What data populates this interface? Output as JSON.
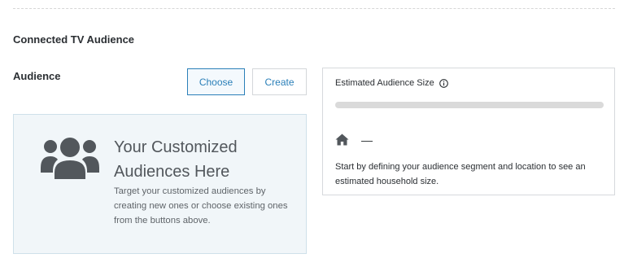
{
  "section": {
    "title": "Connected TV Audience"
  },
  "audience": {
    "label": "Audience",
    "choose_label": "Choose",
    "create_label": "Create"
  },
  "placeholder": {
    "icon": "people-group-icon",
    "title": "Your Customized Audiences Here",
    "text": "Target your customized audiences by creating new ones or choose existing ones from the buttons above."
  },
  "estimate": {
    "title": "Estimated Audience Size",
    "info_icon": "info-icon",
    "progress_fraction": 0,
    "household_icon": "home-icon",
    "household_value": "—",
    "help_text": "Start by defining your audience segment and location to see an estimated household size."
  },
  "colors": {
    "accent": "#2a7fb8",
    "card_background": "#f1f6f9",
    "progress_track": "#dadada",
    "icon_gray": "#52575c"
  }
}
